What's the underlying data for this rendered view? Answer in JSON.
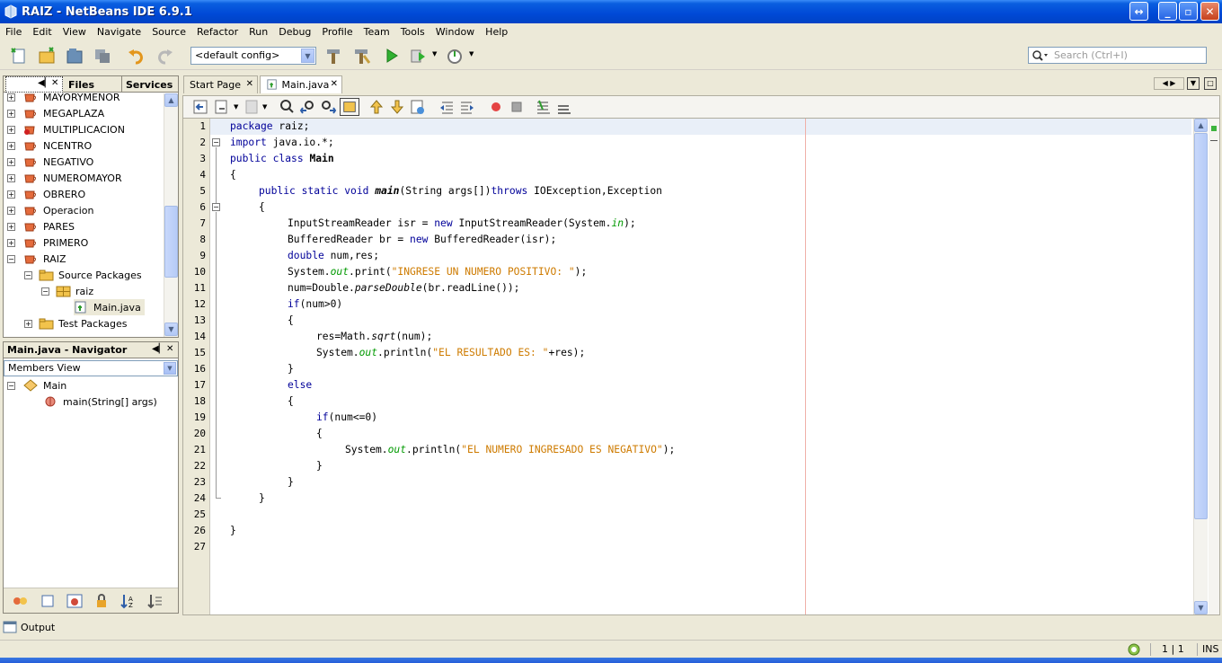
{
  "window": {
    "title": "RAIZ - NetBeans IDE 6.9.1",
    "buttons": {
      "resize": "↔",
      "minimize": "_",
      "maximize": "▫",
      "close": "✕"
    }
  },
  "menu": [
    "File",
    "Edit",
    "View",
    "Navigate",
    "Source",
    "Refactor",
    "Run",
    "Debug",
    "Profile",
    "Team",
    "Tools",
    "Window",
    "Help"
  ],
  "toolbar": {
    "config_value": "<default config>",
    "search_placeholder": "Search (Ctrl+I)"
  },
  "projects_panel": {
    "tabs": [
      "Files",
      "Services"
    ],
    "items": [
      {
        "label": "MAYORYMENOR",
        "kind": "project"
      },
      {
        "label": "MEGAPLAZA",
        "kind": "project"
      },
      {
        "label": "MULTIPLICACION",
        "kind": "project"
      },
      {
        "label": "NCENTRO",
        "kind": "project"
      },
      {
        "label": "NEGATIVO",
        "kind": "project"
      },
      {
        "label": "NUMEROMAYOR",
        "kind": "project"
      },
      {
        "label": "OBRERO",
        "kind": "project"
      },
      {
        "label": "Operacion",
        "kind": "project"
      },
      {
        "label": "PARES",
        "kind": "project"
      },
      {
        "label": "PRIMERO",
        "kind": "project"
      },
      {
        "label": "RAIZ",
        "kind": "project"
      },
      {
        "label": "Source Packages",
        "kind": "folder"
      },
      {
        "label": "raiz",
        "kind": "package"
      },
      {
        "label": "Main.java",
        "kind": "java"
      },
      {
        "label": "Test Packages",
        "kind": "folder"
      }
    ]
  },
  "navigator": {
    "title": "Main.java - Navigator",
    "view": "Members View",
    "items": [
      "Main",
      "main(String[] args)"
    ]
  },
  "editor": {
    "tabs": [
      "Start Page",
      "Main.java"
    ],
    "active_tab": "Main.java",
    "line_numbers": [
      "1",
      "2",
      "3",
      "4",
      "5",
      "6",
      "7",
      "8",
      "9",
      "10",
      "11",
      "12",
      "13",
      "14",
      "15",
      "16",
      "17",
      "18",
      "19",
      "20",
      "21",
      "22",
      "23",
      "24",
      "25",
      "26",
      "27"
    ],
    "code": {
      "l1_kw": "package",
      "l1_rest": " raiz;",
      "l2_kw": "import",
      "l2_rest": " java.io.*;",
      "l3_kw": "public class",
      "l3_name": "Main",
      "l4": "{",
      "l5_kw": "public static void",
      "l5_name": "main",
      "l5_rest": "(String args[])",
      "l5_throws": "throws",
      "l5_ex": " IOException,Exception",
      "l6": "{",
      "l7_a": "InputStreamReader isr = ",
      "l7_new": "new",
      "l7_b": " InputStreamReader(System.",
      "l7_in": "in",
      "l7_c": ");",
      "l8_a": "BufferedReader br = ",
      "l8_new": "new",
      "l8_b": " BufferedReader(isr);",
      "l9_kw": "double",
      "l9_rest": " num,res;",
      "l10_a": "System.",
      "l10_out": "out",
      "l10_b": ".print(",
      "l10_str": "\"INGRESE UN NUMERO POSITIVO: \"",
      "l10_c": ");",
      "l11_a": "num=Double.",
      "l11_m": "parseDouble",
      "l11_b": "(br.readLine());",
      "l12_kw": "if",
      "l12_rest": "(num>0)",
      "l13": "{",
      "l14_a": "res=Math.",
      "l14_m": "sqrt",
      "l14_b": "(num);",
      "l15_a": "System.",
      "l15_out": "out",
      "l15_b": ".println(",
      "l15_str": "\"EL RESULTADO ES: \"",
      "l15_c": "+res);",
      "l16": "}",
      "l17_kw": "else",
      "l18": "{",
      "l19_kw": "if",
      "l19_rest": "(num<=0)",
      "l20": "{",
      "l21_a": "System.",
      "l21_out": "out",
      "l21_b": ".println(",
      "l21_str": "\"EL NUMERO INGRESADO ES NEGATIVO\"",
      "l21_c": ");",
      "l22": "}",
      "l23": "}",
      "l24": "}",
      "l26": "}"
    }
  },
  "output_label": "Output",
  "status": {
    "position": "1 | 1",
    "mode": "INS"
  },
  "colors": {
    "keyword": "#000099",
    "string": "#ce7b00",
    "field": "#009900",
    "titlebar": "#0049d6"
  }
}
